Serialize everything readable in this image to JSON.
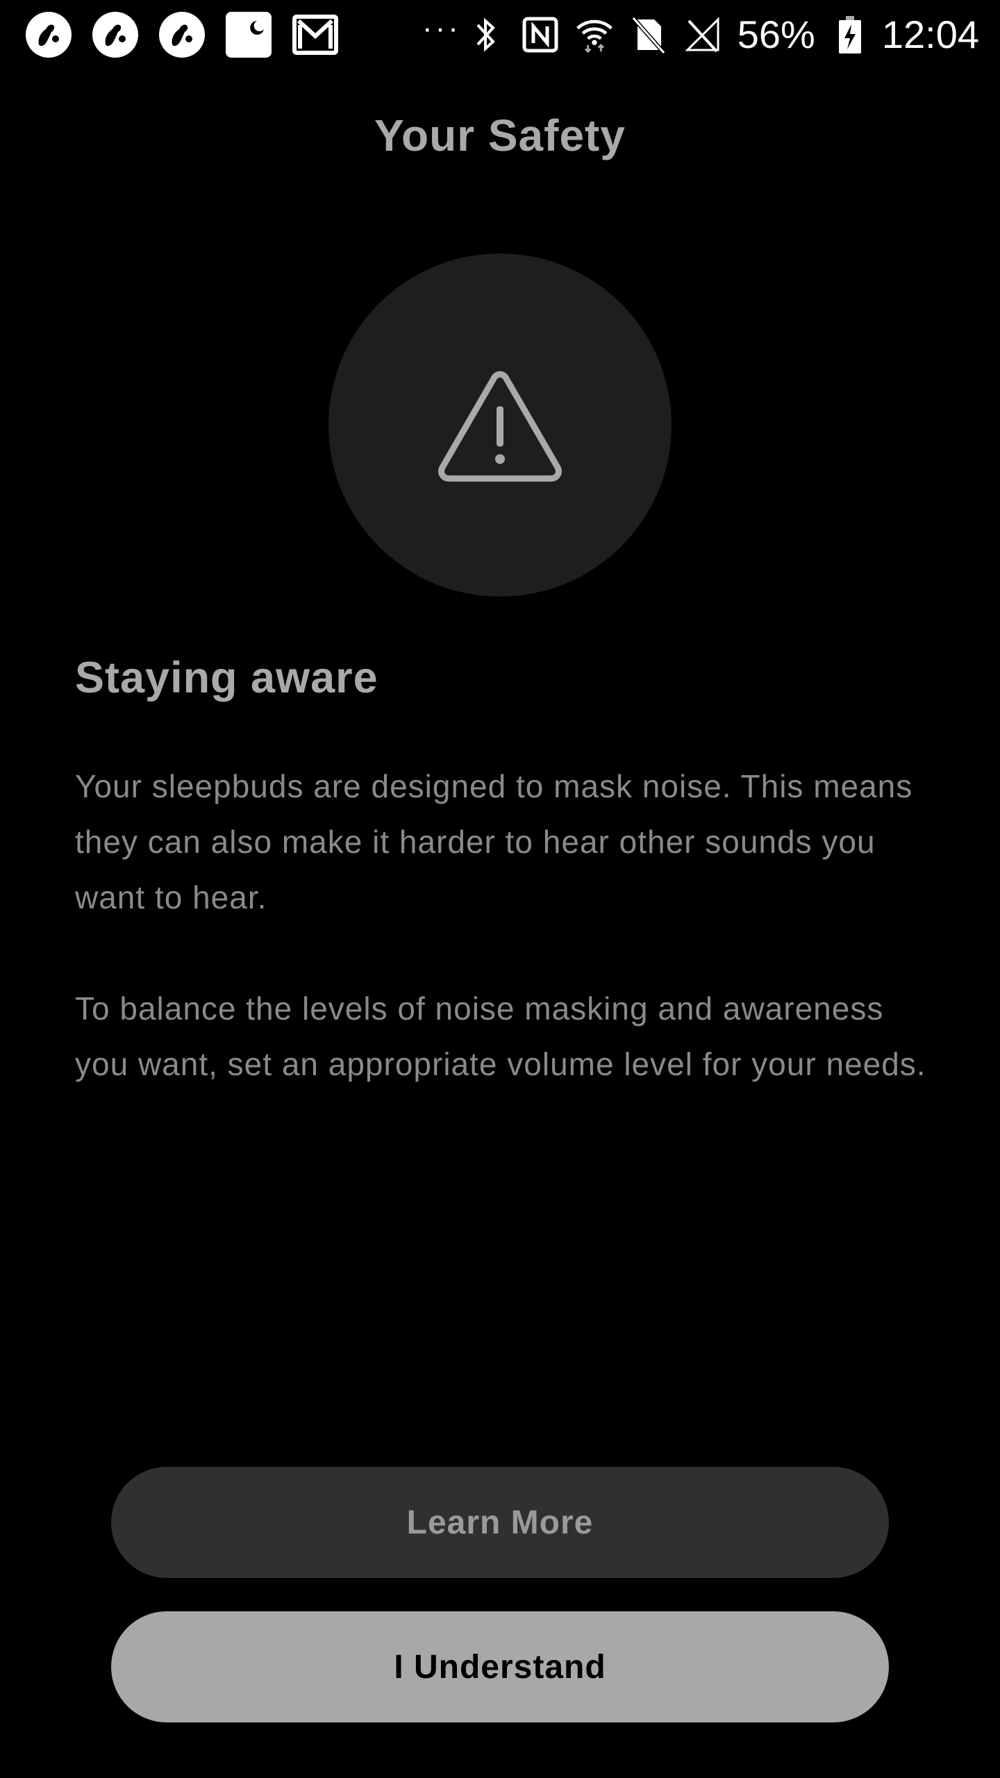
{
  "status_bar": {
    "notification_icons": [
      "sleepbuds-app-icon",
      "sleepbuds-app-icon",
      "sleepbuds-app-icon",
      "do-not-disturb-moon-icon",
      "gmail-icon"
    ],
    "more_indicator": "···",
    "system_icons": [
      "bluetooth-icon",
      "nfc-icon",
      "wifi-icon",
      "no-sim-icon",
      "cell-signal-icon"
    ],
    "battery_percent": "56%",
    "time": "12:04"
  },
  "header": {
    "title": "Your Safety"
  },
  "hero": {
    "icon": "warning-triangle-icon"
  },
  "content": {
    "heading": "Staying aware",
    "paragraph_1": "Your sleepbuds are designed to mask noise. This means they can also make it harder to hear other sounds you want to hear.",
    "paragraph_2": "To balance the levels of noise masking and awareness you want, set an appropriate volume level for your needs."
  },
  "actions": {
    "learn_more_label": "Learn More",
    "understand_label": "I Understand"
  },
  "colors": {
    "background": "#000000",
    "circle": "#1e1e1e",
    "secondary_button": "#303030",
    "primary_button": "#a8a8a8",
    "text_muted": "#8a8a8a"
  }
}
